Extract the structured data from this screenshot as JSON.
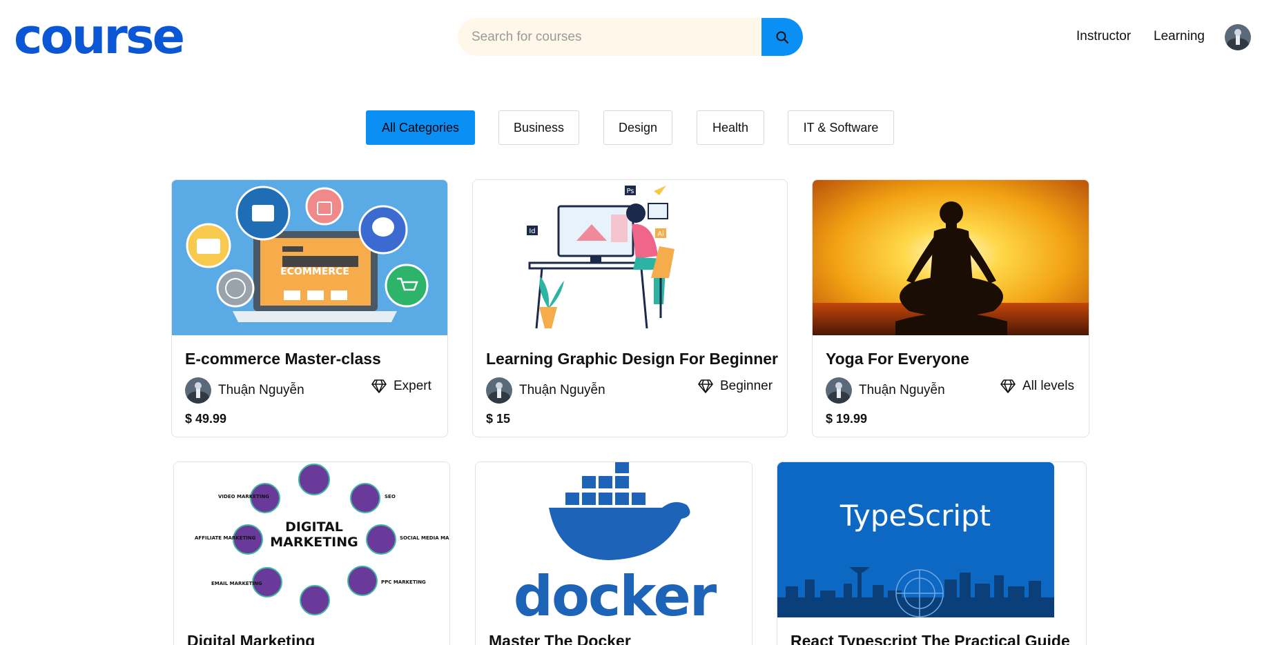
{
  "header": {
    "logo": "course",
    "search": {
      "placeholder": "Search for courses"
    },
    "nav": {
      "instructor": "Instructor",
      "learning": "Learning"
    }
  },
  "categories": [
    "All Categories",
    "Business",
    "Design",
    "Health",
    "IT & Software"
  ],
  "courses": [
    {
      "title": "E-commerce Master-class",
      "author": "Thuận Nguyễn",
      "level": "Expert",
      "price": "$ 49.99",
      "image": "ecommerce-illustration"
    },
    {
      "title": "Learning Graphic Design For Beginner",
      "author": "Thuận Nguyễn",
      "level": "Beginner",
      "price": "$ 15",
      "image": "graphic-designer-illustration"
    },
    {
      "title": "Yoga For Everyone",
      "author": "Thuận Nguyễn",
      "level": "All levels",
      "price": "$ 19.99",
      "image": "yoga-sunset-photo"
    },
    {
      "title": "Digital Marketing",
      "image": "digital-marketing-diagram",
      "image_text": {
        "center": [
          "DIGITAL",
          "MARKETING"
        ],
        "labels": [
          "VIDEO MARKETING",
          "SEO",
          "AFFILIATE MARKETING",
          "SOCIAL MEDIA MARKETING",
          "EMAIL MARKETING",
          "PPC MARKETING"
        ]
      }
    },
    {
      "title": "Master The Docker",
      "image": "docker-logo",
      "image_text": {
        "wordmark": "docker"
      }
    },
    {
      "title": "React Typescript The Practical Guide",
      "image": "typescript-skyline",
      "image_text": {
        "wordmark": "TypeScript"
      }
    }
  ],
  "colors": {
    "brand": "#0a56d4",
    "accent": "#0a8ff5",
    "search_bg": "#fff7ea"
  },
  "design_labels": {
    "ps": "Ps",
    "id": "Id",
    "ai": "Ai"
  },
  "ecommerce_label": "ECOMMERCE"
}
